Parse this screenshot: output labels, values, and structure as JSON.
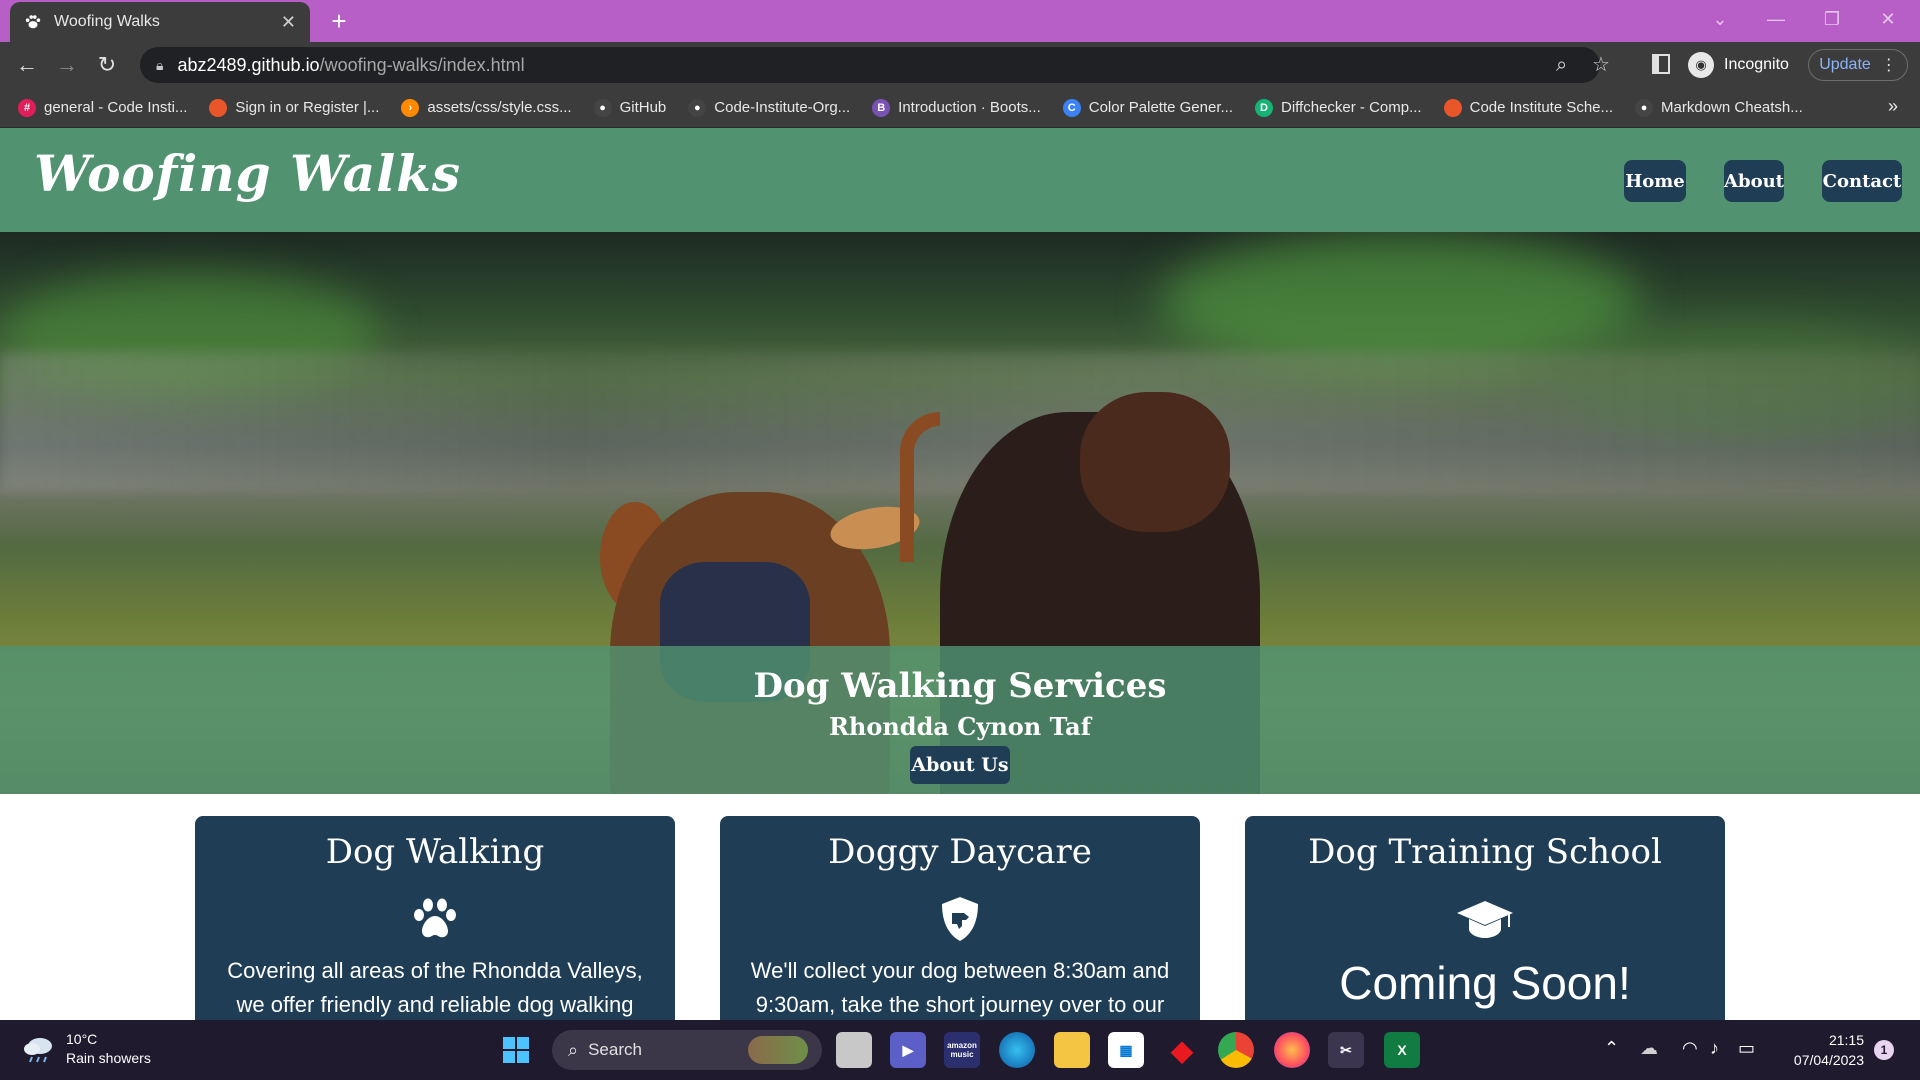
{
  "browser": {
    "tab_title": "Woofing Walks",
    "tab_close": "✕",
    "new_tab": "+",
    "url_host": "abz2489.github.io",
    "url_path": "/woofing-walks/index.html",
    "profile_label": "Incognito",
    "update_label": "Update",
    "bookmarks": [
      {
        "label": "general - Code Insti...",
        "icon": "slack-icon",
        "color": "#e01e5a",
        "glyph": "#"
      },
      {
        "label": "Sign in or Register |...",
        "icon": "circle-icon",
        "color": "#e8562a",
        "glyph": ""
      },
      {
        "label": "assets/css/style.css...",
        "icon": "gitpod-icon",
        "color": "#ff8a00",
        "glyph": "›"
      },
      {
        "label": "GitHub",
        "icon": "github-icon",
        "color": "#444444",
        "glyph": "●"
      },
      {
        "label": "Code-Institute-Org...",
        "icon": "github-icon",
        "color": "#444444",
        "glyph": "●"
      },
      {
        "label": "Introduction · Boots...",
        "icon": "bootstrap-icon",
        "color": "#7952b3",
        "glyph": "B"
      },
      {
        "label": "Color Palette Gener...",
        "icon": "coolors-icon",
        "color": "#3b82f6",
        "glyph": "C"
      },
      {
        "label": "Diffchecker - Comp...",
        "icon": "diffchecker-icon",
        "color": "#15b374",
        "glyph": "D"
      },
      {
        "label": "Code Institute Sche...",
        "icon": "circle-icon",
        "color": "#e8562a",
        "glyph": ""
      },
      {
        "label": "Markdown Cheatsh...",
        "icon": "github-icon",
        "color": "#444444",
        "glyph": "●"
      }
    ],
    "bookmarks_more": "»"
  },
  "site": {
    "logo": "Woofing Walks",
    "nav": {
      "home": "Home",
      "about": "About",
      "contact": "Contact"
    },
    "hero": {
      "title": "Dog Walking Services",
      "subtitle": "Rhondda Cynon Taf",
      "button": "About Us"
    },
    "cards": [
      {
        "title": "Dog Walking",
        "icon": "paw-icon",
        "text": "Covering all areas of the Rhondda Valleys, we offer friendly and reliable dog walking"
      },
      {
        "title": "Doggy Daycare",
        "icon": "shield-dog-icon",
        "text": "We'll collect your dog between 8:30am and 9:30am, take the short journey over to our"
      },
      {
        "title": "Dog Training School",
        "icon": "graduation-cap-icon",
        "text": "Coming Soon!"
      }
    ],
    "colors": {
      "header_green": "#519271",
      "navy": "#1f3e55"
    }
  },
  "taskbar": {
    "weather_temp": "10°C",
    "weather_desc": "Rain showers",
    "search_label": "Search",
    "time": "21:15",
    "date": "07/04/2023",
    "notification_count": "1",
    "music_label": "amazon music",
    "excel_label": "X"
  }
}
